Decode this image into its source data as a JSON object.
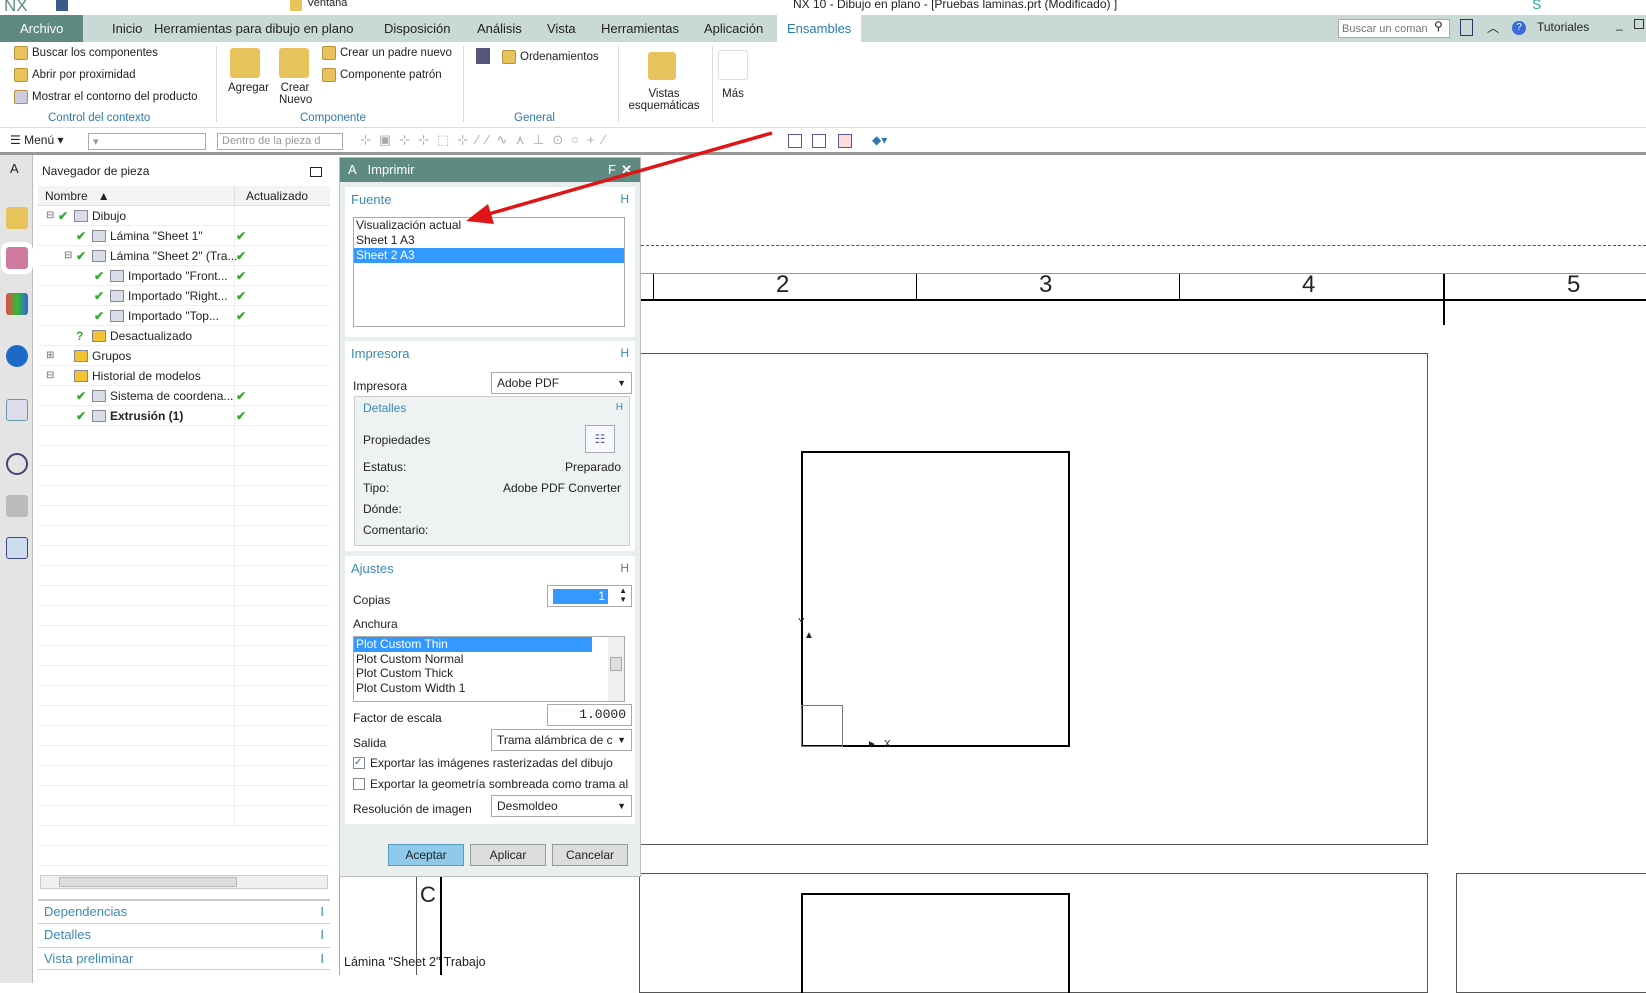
{
  "titlebar": {
    "logo": "NX",
    "title": "NX 10 - Dibujo en plano - [Pruebas laminas.prt (Modificado) ]",
    "window_menu": "Ventana",
    "accent": "#5e8a82"
  },
  "tabs": [
    "Archivo",
    "Inicio",
    "Herramientas para dibujo en plano",
    "Disposición",
    "Análisis",
    "Vista",
    "Herramientas",
    "Aplicación",
    "Ensambles"
  ],
  "search": {
    "placeholder": "Buscar un coman",
    "tutorials": "Tutoriales"
  },
  "ribbon": {
    "context": {
      "items": [
        "Buscar los componentes",
        "Abrir por proximidad",
        "Mostrar el contorno del producto"
      ],
      "label": "Control del contexto"
    },
    "component": {
      "add": "Agregar",
      "create": "Crear Nuevo",
      "items": [
        "Crear un padre nuevo",
        "Componente patrón"
      ],
      "label": "Componente"
    },
    "general": {
      "items": [
        "Ordenamientos"
      ],
      "label": "General"
    },
    "schematic": "Vistas esquemáticas",
    "more": "Más"
  },
  "toolbar": {
    "menu": "Menú",
    "filter_placeholder": "Dentro de la pieza d"
  },
  "navigator": {
    "title": "Navegador de pieza",
    "col_name": "Nombre",
    "col_updated": "Actualizado",
    "rows": [
      {
        "label": "Dibujo",
        "indent": 0,
        "check": true,
        "updated": false,
        "bold": false
      },
      {
        "label": "Lámina \"Sheet 1\"",
        "indent": 1,
        "check": true,
        "updated": true,
        "bold": false
      },
      {
        "label": "Lámina \"Sheet 2\" (Tra...",
        "indent": 1,
        "check": true,
        "updated": true,
        "bold": false
      },
      {
        "label": "Importado \"Front...",
        "indent": 2,
        "check": true,
        "updated": true,
        "bold": false
      },
      {
        "label": "Importado \"Right...",
        "indent": 2,
        "check": true,
        "updated": true,
        "bold": false
      },
      {
        "label": "Importado \"Top...",
        "indent": 2,
        "check": true,
        "updated": true,
        "bold": false
      },
      {
        "label": "Desactualizado",
        "indent": 1,
        "check": false,
        "updated": false,
        "bold": false
      },
      {
        "label": "Grupos",
        "indent": 0,
        "check": false,
        "updated": false,
        "bold": false
      },
      {
        "label": "Historial de modelos",
        "indent": 0,
        "check": false,
        "updated": false,
        "bold": false
      },
      {
        "label": "Sistema de coordena...",
        "indent": 1,
        "check": true,
        "updated": true,
        "bold": false
      },
      {
        "label": "Extrusión (1)",
        "indent": 1,
        "check": true,
        "updated": true,
        "bold": true
      }
    ],
    "panels": [
      "Dependencias",
      "Detalles",
      "Vista preliminar"
    ]
  },
  "dialog": {
    "title": "Imprimir",
    "source": {
      "title": "Fuente",
      "items": [
        "Visualización actual",
        "Sheet 1  A3",
        "Sheet 2  A3"
      ],
      "selected": 2
    },
    "printer": {
      "title": "Impresora",
      "label": "Impresora",
      "value": "Adobe PDF",
      "details": {
        "title": "Detalles",
        "properties": "Propiedades",
        "status_label": "Estatus:",
        "status": "Preparado",
        "type_label": "Tipo:",
        "type": "Adobe PDF Converter",
        "where_label": "Dónde:",
        "comment_label": "Comentario:"
      }
    },
    "settings": {
      "title": "Ajustes",
      "copies_label": "Copias",
      "copies": "1",
      "width_label": "Anchura",
      "widths": [
        "Plot Custom Thin",
        "Plot Custom Normal",
        "Plot Custom Thick",
        "Plot Custom Width 1"
      ],
      "scale_label": "Factor de escala",
      "scale": "1.0000",
      "output_label": "Salida",
      "output": "Trama alámbrica de c",
      "export_raster": "Exportar las imágenes rasterizadas del dibujo",
      "export_raster_checked": true,
      "export_shaded": "Exportar la geometría sombreada como trama al",
      "export_shaded_checked": false,
      "resolution_label": "Resolución de imagen",
      "resolution": "Desmoldeo"
    },
    "buttons": {
      "ok": "Aceptar",
      "apply": "Aplicar",
      "cancel": "Cancelar"
    }
  },
  "drawing": {
    "zones": [
      "2",
      "3",
      "4",
      "5"
    ],
    "row_label": "C",
    "axis_x": "X",
    "axis_y": "Y"
  },
  "status": "Lámina \"Sheet 2\" Trabajo"
}
